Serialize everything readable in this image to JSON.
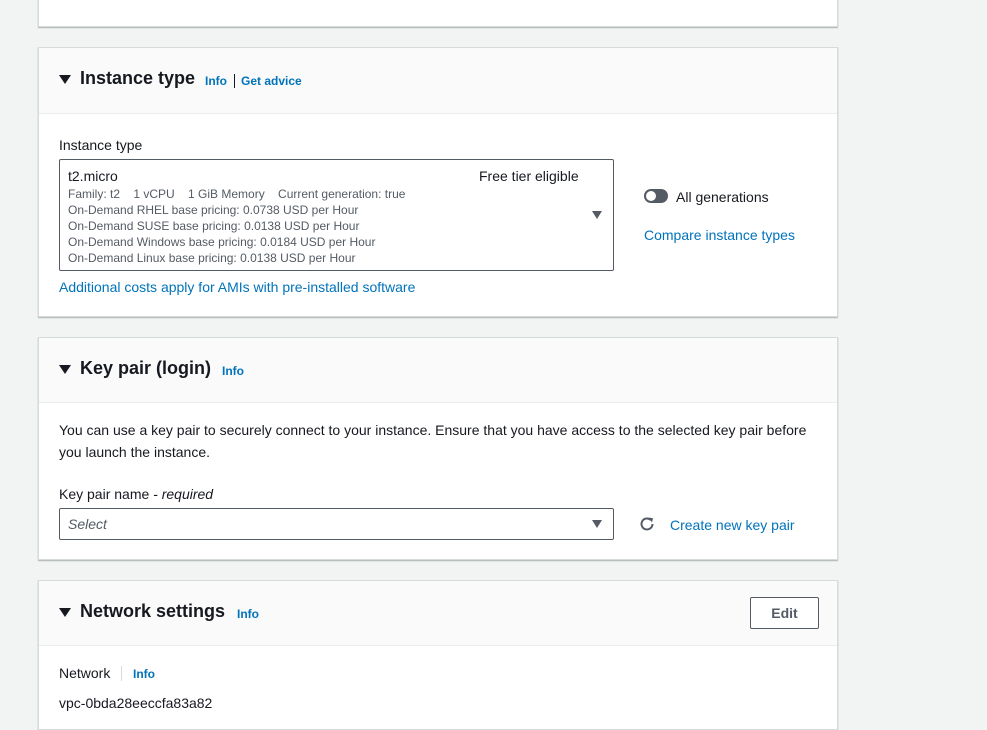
{
  "instance_type": {
    "title": "Instance type",
    "info": "Info",
    "get_advice": "Get advice",
    "field_label": "Instance type",
    "selected": {
      "name": "t2.micro",
      "free_tier": "Free tier eligible",
      "details": "Family: t2    1 vCPU    1 GiB Memory    Current generation: true",
      "pricing": [
        "On-Demand RHEL base pricing: 0.0738 USD per Hour",
        "On-Demand SUSE base pricing: 0.0138 USD per Hour",
        "On-Demand Windows base pricing: 0.0184 USD per Hour",
        "On-Demand Linux base pricing: 0.0138 USD per Hour"
      ]
    },
    "all_generations_label": "All generations",
    "compare_link": "Compare instance types",
    "additional_costs_link": "Additional costs apply for AMIs with pre-installed software"
  },
  "key_pair": {
    "title": "Key pair (login)",
    "info": "Info",
    "description_line1": "You can use a key pair to securely connect to your instance. Ensure that you have access to the selected key pair before",
    "description_line2": "you launch the instance.",
    "field_label": "Key pair name",
    "required_suffix": " - required",
    "select_placeholder": "Select",
    "create_link": "Create new key pair"
  },
  "network": {
    "title": "Network settings",
    "info": "Info",
    "edit_button": "Edit",
    "network_label": "Network",
    "network_info": "Info",
    "vpc_id": "vpc-0bda28eeccfa83a82"
  },
  "colors": {
    "link": "#0073bb",
    "background": "#f2f3f3",
    "text": "#16191f"
  }
}
